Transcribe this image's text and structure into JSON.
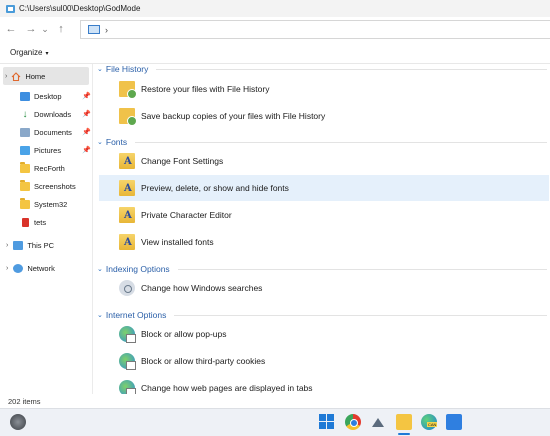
{
  "window": {
    "title": "C:\\Users\\sul00\\Desktop\\GodMode",
    "icon": "folder-window-icon"
  },
  "nav": {
    "back": "←",
    "forward": "→",
    "recent": "⌄",
    "up": "↑",
    "address_chevron": "›"
  },
  "toolbar": {
    "organize_label": "Organize",
    "organize_caret": "▾"
  },
  "sidebar": {
    "home": {
      "label": "Home",
      "expand": "›"
    },
    "quick_access": [
      {
        "label": "Desktop",
        "icon": "desktop-folder-icon",
        "pinned": true
      },
      {
        "label": "Downloads",
        "icon": "downloads-icon",
        "pinned": true
      },
      {
        "label": "Documents",
        "icon": "documents-icon",
        "pinned": true
      },
      {
        "label": "Pictures",
        "icon": "pictures-icon",
        "pinned": true
      },
      {
        "label": "RecForth",
        "icon": "folder-icon",
        "pinned": false
      },
      {
        "label": "Screenshots",
        "icon": "folder-icon",
        "pinned": false
      },
      {
        "label": "System32",
        "icon": "folder-icon",
        "pinned": false
      },
      {
        "label": "tets",
        "icon": "red-file-icon",
        "pinned": false
      }
    ],
    "pin_glyph": "📌",
    "tree": [
      {
        "label": "This PC",
        "expand": "›",
        "icon": "pc-icon"
      },
      {
        "label": "Network",
        "expand": "›",
        "icon": "network-icon"
      }
    ]
  },
  "content": {
    "categories": [
      {
        "title": "File History",
        "items": [
          {
            "label": "Restore your files with File History",
            "icon": "file-history-icon"
          },
          {
            "label": "Save backup copies of your files with File History",
            "icon": "file-history-icon"
          }
        ]
      },
      {
        "title": "Fonts",
        "items": [
          {
            "label": "Change Font Settings",
            "icon": "fonts-folder-icon"
          },
          {
            "label": "Preview, delete, or show and hide fonts",
            "icon": "fonts-folder-icon",
            "highlighted": true
          },
          {
            "label": "Private Character Editor",
            "icon": "fonts-folder-icon"
          },
          {
            "label": "View installed fonts",
            "icon": "fonts-folder-icon"
          }
        ]
      },
      {
        "title": "Indexing Options",
        "items": [
          {
            "label": "Change how Windows searches",
            "icon": "indexing-icon"
          }
        ]
      },
      {
        "title": "Internet Options",
        "items": [
          {
            "label": "Block or allow pop-ups",
            "icon": "internet-options-icon"
          },
          {
            "label": "Block or allow third-party cookies",
            "icon": "internet-options-icon"
          },
          {
            "label": "Change how web pages are displayed in tabs",
            "icon": "internet-options-icon"
          }
        ]
      }
    ],
    "font_glyph": "A"
  },
  "status": {
    "item_count": "202 items"
  },
  "taskbar": {
    "apps": [
      "start-icon",
      "windows-icon",
      "chrome-icon",
      "mountain-app-icon",
      "file-explorer-icon",
      "edge-canary-icon",
      "store-icon"
    ],
    "edge_badge": "CAN"
  },
  "colors": {
    "accent": "#1f7ad6",
    "category_text": "#2a5fa8",
    "selection": "#e5f0fb",
    "sidebar_selected": "#e5e5e5"
  }
}
